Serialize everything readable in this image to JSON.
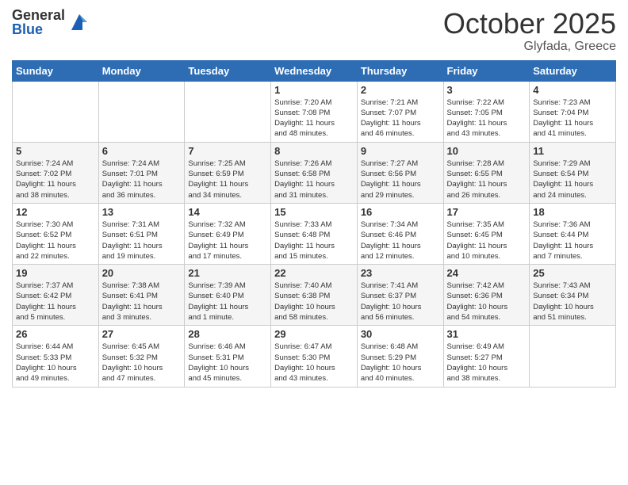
{
  "logo": {
    "general": "General",
    "blue": "Blue"
  },
  "title": "October 2025",
  "location": "Glyfada, Greece",
  "days_of_week": [
    "Sunday",
    "Monday",
    "Tuesday",
    "Wednesday",
    "Thursday",
    "Friday",
    "Saturday"
  ],
  "weeks": [
    [
      {
        "day": "",
        "info": ""
      },
      {
        "day": "",
        "info": ""
      },
      {
        "day": "",
        "info": ""
      },
      {
        "day": "1",
        "info": "Sunrise: 7:20 AM\nSunset: 7:08 PM\nDaylight: 11 hours\nand 48 minutes."
      },
      {
        "day": "2",
        "info": "Sunrise: 7:21 AM\nSunset: 7:07 PM\nDaylight: 11 hours\nand 46 minutes."
      },
      {
        "day": "3",
        "info": "Sunrise: 7:22 AM\nSunset: 7:05 PM\nDaylight: 11 hours\nand 43 minutes."
      },
      {
        "day": "4",
        "info": "Sunrise: 7:23 AM\nSunset: 7:04 PM\nDaylight: 11 hours\nand 41 minutes."
      }
    ],
    [
      {
        "day": "5",
        "info": "Sunrise: 7:24 AM\nSunset: 7:02 PM\nDaylight: 11 hours\nand 38 minutes."
      },
      {
        "day": "6",
        "info": "Sunrise: 7:24 AM\nSunset: 7:01 PM\nDaylight: 11 hours\nand 36 minutes."
      },
      {
        "day": "7",
        "info": "Sunrise: 7:25 AM\nSunset: 6:59 PM\nDaylight: 11 hours\nand 34 minutes."
      },
      {
        "day": "8",
        "info": "Sunrise: 7:26 AM\nSunset: 6:58 PM\nDaylight: 11 hours\nand 31 minutes."
      },
      {
        "day": "9",
        "info": "Sunrise: 7:27 AM\nSunset: 6:56 PM\nDaylight: 11 hours\nand 29 minutes."
      },
      {
        "day": "10",
        "info": "Sunrise: 7:28 AM\nSunset: 6:55 PM\nDaylight: 11 hours\nand 26 minutes."
      },
      {
        "day": "11",
        "info": "Sunrise: 7:29 AM\nSunset: 6:54 PM\nDaylight: 11 hours\nand 24 minutes."
      }
    ],
    [
      {
        "day": "12",
        "info": "Sunrise: 7:30 AM\nSunset: 6:52 PM\nDaylight: 11 hours\nand 22 minutes."
      },
      {
        "day": "13",
        "info": "Sunrise: 7:31 AM\nSunset: 6:51 PM\nDaylight: 11 hours\nand 19 minutes."
      },
      {
        "day": "14",
        "info": "Sunrise: 7:32 AM\nSunset: 6:49 PM\nDaylight: 11 hours\nand 17 minutes."
      },
      {
        "day": "15",
        "info": "Sunrise: 7:33 AM\nSunset: 6:48 PM\nDaylight: 11 hours\nand 15 minutes."
      },
      {
        "day": "16",
        "info": "Sunrise: 7:34 AM\nSunset: 6:46 PM\nDaylight: 11 hours\nand 12 minutes."
      },
      {
        "day": "17",
        "info": "Sunrise: 7:35 AM\nSunset: 6:45 PM\nDaylight: 11 hours\nand 10 minutes."
      },
      {
        "day": "18",
        "info": "Sunrise: 7:36 AM\nSunset: 6:44 PM\nDaylight: 11 hours\nand 7 minutes."
      }
    ],
    [
      {
        "day": "19",
        "info": "Sunrise: 7:37 AM\nSunset: 6:42 PM\nDaylight: 11 hours\nand 5 minutes."
      },
      {
        "day": "20",
        "info": "Sunrise: 7:38 AM\nSunset: 6:41 PM\nDaylight: 11 hours\nand 3 minutes."
      },
      {
        "day": "21",
        "info": "Sunrise: 7:39 AM\nSunset: 6:40 PM\nDaylight: 11 hours\nand 1 minute."
      },
      {
        "day": "22",
        "info": "Sunrise: 7:40 AM\nSunset: 6:38 PM\nDaylight: 10 hours\nand 58 minutes."
      },
      {
        "day": "23",
        "info": "Sunrise: 7:41 AM\nSunset: 6:37 PM\nDaylight: 10 hours\nand 56 minutes."
      },
      {
        "day": "24",
        "info": "Sunrise: 7:42 AM\nSunset: 6:36 PM\nDaylight: 10 hours\nand 54 minutes."
      },
      {
        "day": "25",
        "info": "Sunrise: 7:43 AM\nSunset: 6:34 PM\nDaylight: 10 hours\nand 51 minutes."
      }
    ],
    [
      {
        "day": "26",
        "info": "Sunrise: 6:44 AM\nSunset: 5:33 PM\nDaylight: 10 hours\nand 49 minutes."
      },
      {
        "day": "27",
        "info": "Sunrise: 6:45 AM\nSunset: 5:32 PM\nDaylight: 10 hours\nand 47 minutes."
      },
      {
        "day": "28",
        "info": "Sunrise: 6:46 AM\nSunset: 5:31 PM\nDaylight: 10 hours\nand 45 minutes."
      },
      {
        "day": "29",
        "info": "Sunrise: 6:47 AM\nSunset: 5:30 PM\nDaylight: 10 hours\nand 43 minutes."
      },
      {
        "day": "30",
        "info": "Sunrise: 6:48 AM\nSunset: 5:29 PM\nDaylight: 10 hours\nand 40 minutes."
      },
      {
        "day": "31",
        "info": "Sunrise: 6:49 AM\nSunset: 5:27 PM\nDaylight: 10 hours\nand 38 minutes."
      },
      {
        "day": "",
        "info": ""
      }
    ]
  ]
}
